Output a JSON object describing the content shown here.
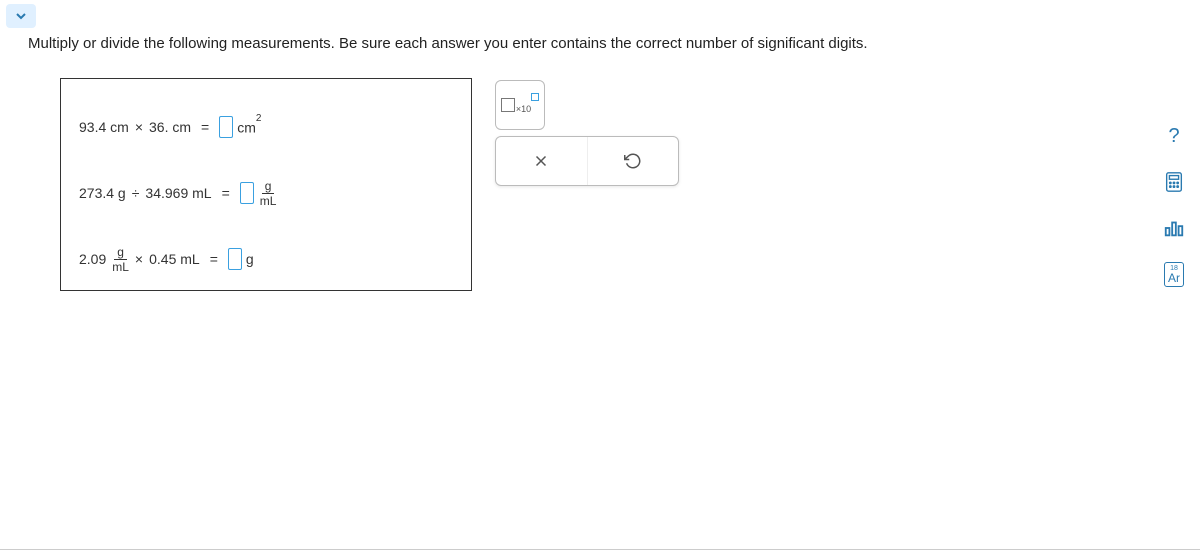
{
  "question": {
    "text": "Multiply or divide the following measurements. Be sure each answer you enter contains the correct number of significant digits."
  },
  "equations": {
    "eq1": {
      "a": "93.4 cm",
      "op": "×",
      "b": "36. cm",
      "unit": "cm",
      "exp": "2"
    },
    "eq2": {
      "a": "273.4 g",
      "op": "÷",
      "b": "34.969 mL",
      "unit_num": "g",
      "unit_den": "mL"
    },
    "eq3": {
      "coef": "2.09",
      "frac_num": "g",
      "frac_den": "mL",
      "op": "×",
      "b": "0.45 mL",
      "unit": "g"
    }
  },
  "tools": {
    "x10_label": "×10"
  },
  "actions": {
    "clear": "×",
    "reset": "↺"
  },
  "side": {
    "help": "?",
    "calculator": "calc",
    "graph": "graph",
    "ar_num": "18",
    "ar_sym": "Ar"
  }
}
